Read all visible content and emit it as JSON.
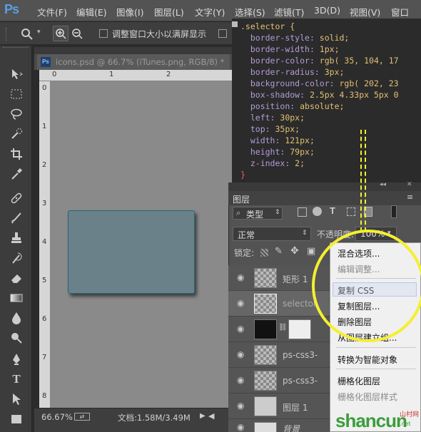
{
  "app": {
    "logo": "Ps"
  },
  "menu": [
    "文件(F)",
    "编辑(E)",
    "图像(I)",
    "图层(L)",
    "文字(Y)",
    "选择(S)",
    "滤镜(T)",
    "3D(D)",
    "视图(V)",
    "窗口"
  ],
  "options": {
    "fit_label": "调整窗口大小以满屏显示"
  },
  "document": {
    "tab_title": "icons.psd @ 66.7% (iTunes.png, RGB/8) *",
    "tab_icon": "Ps"
  },
  "rulers": {
    "top": [
      "0",
      "1",
      "2"
    ],
    "left": [
      "0",
      "1",
      "2",
      "3",
      "4",
      "5",
      "6",
      "7",
      "8"
    ]
  },
  "status": {
    "zoom": "66.67%",
    "doc_info": "文档:1.58M/3.49M"
  },
  "css_code": [
    {
      "kind": "sel",
      "text": ".selector {"
    },
    {
      "kind": "decl",
      "prop": "border-style",
      "val": "solid;"
    },
    {
      "kind": "decl",
      "prop": "border-width",
      "val": "1px;"
    },
    {
      "kind": "decl",
      "prop": "border-color",
      "val": "rgb( 35, 104, 17"
    },
    {
      "kind": "decl",
      "prop": "border-radius",
      "val": "3px;"
    },
    {
      "kind": "decl",
      "prop": "background-color",
      "val": "rgb( 202, 23"
    },
    {
      "kind": "decl",
      "prop": "box-shadow",
      "val": "2.5px 4.33px 5px 0"
    },
    {
      "kind": "decl",
      "prop": "position",
      "val": "absolute;"
    },
    {
      "kind": "decl",
      "prop": "left",
      "val": "30px;"
    },
    {
      "kind": "decl",
      "prop": "top",
      "val": "35px;"
    },
    {
      "kind": "decl",
      "prop": "width",
      "val": "121px;"
    },
    {
      "kind": "decl",
      "prop": "height",
      "val": "79px;"
    },
    {
      "kind": "decl",
      "prop": "z-index",
      "val": "2;"
    },
    {
      "kind": "close",
      "text": "}"
    }
  ],
  "layers_panel": {
    "tab": "图层",
    "filter_label": "类型",
    "blend_mode": "正常",
    "opacity_label": "不透明度:",
    "opacity_value": "100%",
    "lock_label": "锁定:",
    "layers": [
      {
        "name": "矩形 1",
        "selected": false,
        "type": "shape"
      },
      {
        "name": "selector",
        "selected": true,
        "type": "shape"
      },
      {
        "name": "",
        "selected": false,
        "type": "mask"
      },
      {
        "name": "ps-css3-",
        "selected": false,
        "type": "image"
      },
      {
        "name": "ps-css3-",
        "selected": false,
        "type": "image"
      },
      {
        "name": "图层 1",
        "selected": false,
        "type": "image"
      },
      {
        "name": "背景",
        "selected": false,
        "type": "image"
      }
    ]
  },
  "context_menu": {
    "items": [
      {
        "label": "混合选项...",
        "disabled": false
      },
      {
        "label": "编辑调整...",
        "disabled": true
      },
      {
        "label": "复制 CSS",
        "disabled": false
      },
      {
        "label": "复制图层...",
        "disabled": false
      },
      {
        "label": "删除图层",
        "disabled": false
      },
      {
        "label": "从图层建立组...",
        "disabled": false
      },
      {
        "label": "转换为智能对象",
        "disabled": false
      },
      {
        "label": "栅格化图层",
        "disabled": false
      },
      {
        "label": "栅格化图层样式",
        "disabled": true
      }
    ]
  },
  "watermark": {
    "text": "shancun",
    "sub1": "山村网",
    "sub2": ".net"
  },
  "colors": {
    "highlight": "#f3ef30",
    "shape_fill": "#6b8189",
    "shape_border": "#23687a"
  }
}
